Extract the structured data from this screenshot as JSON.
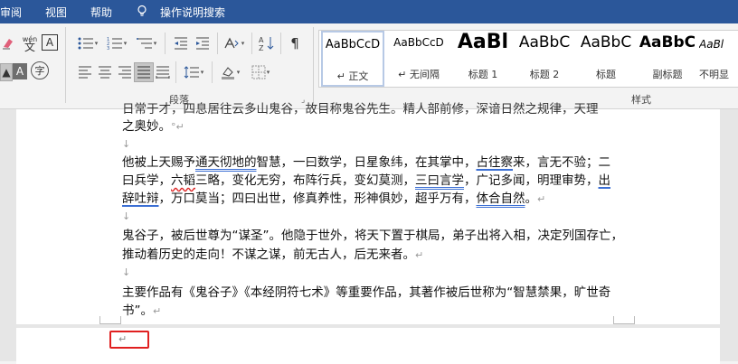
{
  "menubar": {
    "items": [
      "审阅",
      "视图",
      "帮助"
    ],
    "search_label": "操作说明搜索"
  },
  "ribbon": {
    "font_group": {
      "phonetic_guide_label": "wén\n文",
      "char_border_label": "A",
      "highlight_label": "A",
      "enclose_char_label": "字"
    },
    "paragraph_group": {
      "label": "段落",
      "sort_label": "A↓Z"
    },
    "styles_group": {
      "label": "样式",
      "items": [
        {
          "sample": "AaBbCcD",
          "name": "正文"
        },
        {
          "sample": "AaBbCcD",
          "name": "无间隔"
        },
        {
          "sample": "AaBl",
          "name": "标题 1"
        },
        {
          "sample": "AaBbC",
          "name": "标题 2"
        },
        {
          "sample": "AaBbC",
          "name": "标题"
        },
        {
          "sample": "AaBbC",
          "name": "副标题"
        },
        {
          "sample": "AaBl",
          "name": "不明显"
        }
      ]
    }
  },
  "document": {
    "line0": "日常于才，四息居往云多山鬼谷，故目称鬼谷先生。精人部前修，深谙日然之规律，天理",
    "line1": "之奥妙。",
    "para1": {
      "line1_a": "他被上天赐予",
      "line1_b": "通天彻地的",
      "line1_c": "智慧，一曰数学，日星象纬，在其掌中，",
      "line1_d": "占往察",
      "line1_e": "来，言无不验；二",
      "line2_a": "曰兵学，",
      "line2_b": "六韬",
      "line2_c": "三略，变化无穷，布阵行兵，变幻莫测，",
      "line2_d": "三曰言学",
      "line2_e": "，广记多闻，明理审势，",
      "line2_f": "出",
      "line3_a": "辞吐辩",
      "line3_b": "，万口莫当；四曰出世，修真养性，形神俱妙，超乎万有，",
      "line3_c": "体合自然",
      "line3_d": "。"
    },
    "para2": {
      "line1": "鬼谷子，被后世尊为“谋圣”。他隐于世外，将天下置于棋局，弟子出将入相，决定列国存亡，",
      "line2": "推动着历史的走向！不谋之谋，前无古人，后无来者。"
    },
    "para3": {
      "line1": "主要作品有《鬼谷子》《本经阴符七术》等重要作品，其著作被后世称为“智慧禁果，旷世奇",
      "line2": "书”。"
    },
    "para_mark": "↵",
    "empty_mark": "↓"
  }
}
